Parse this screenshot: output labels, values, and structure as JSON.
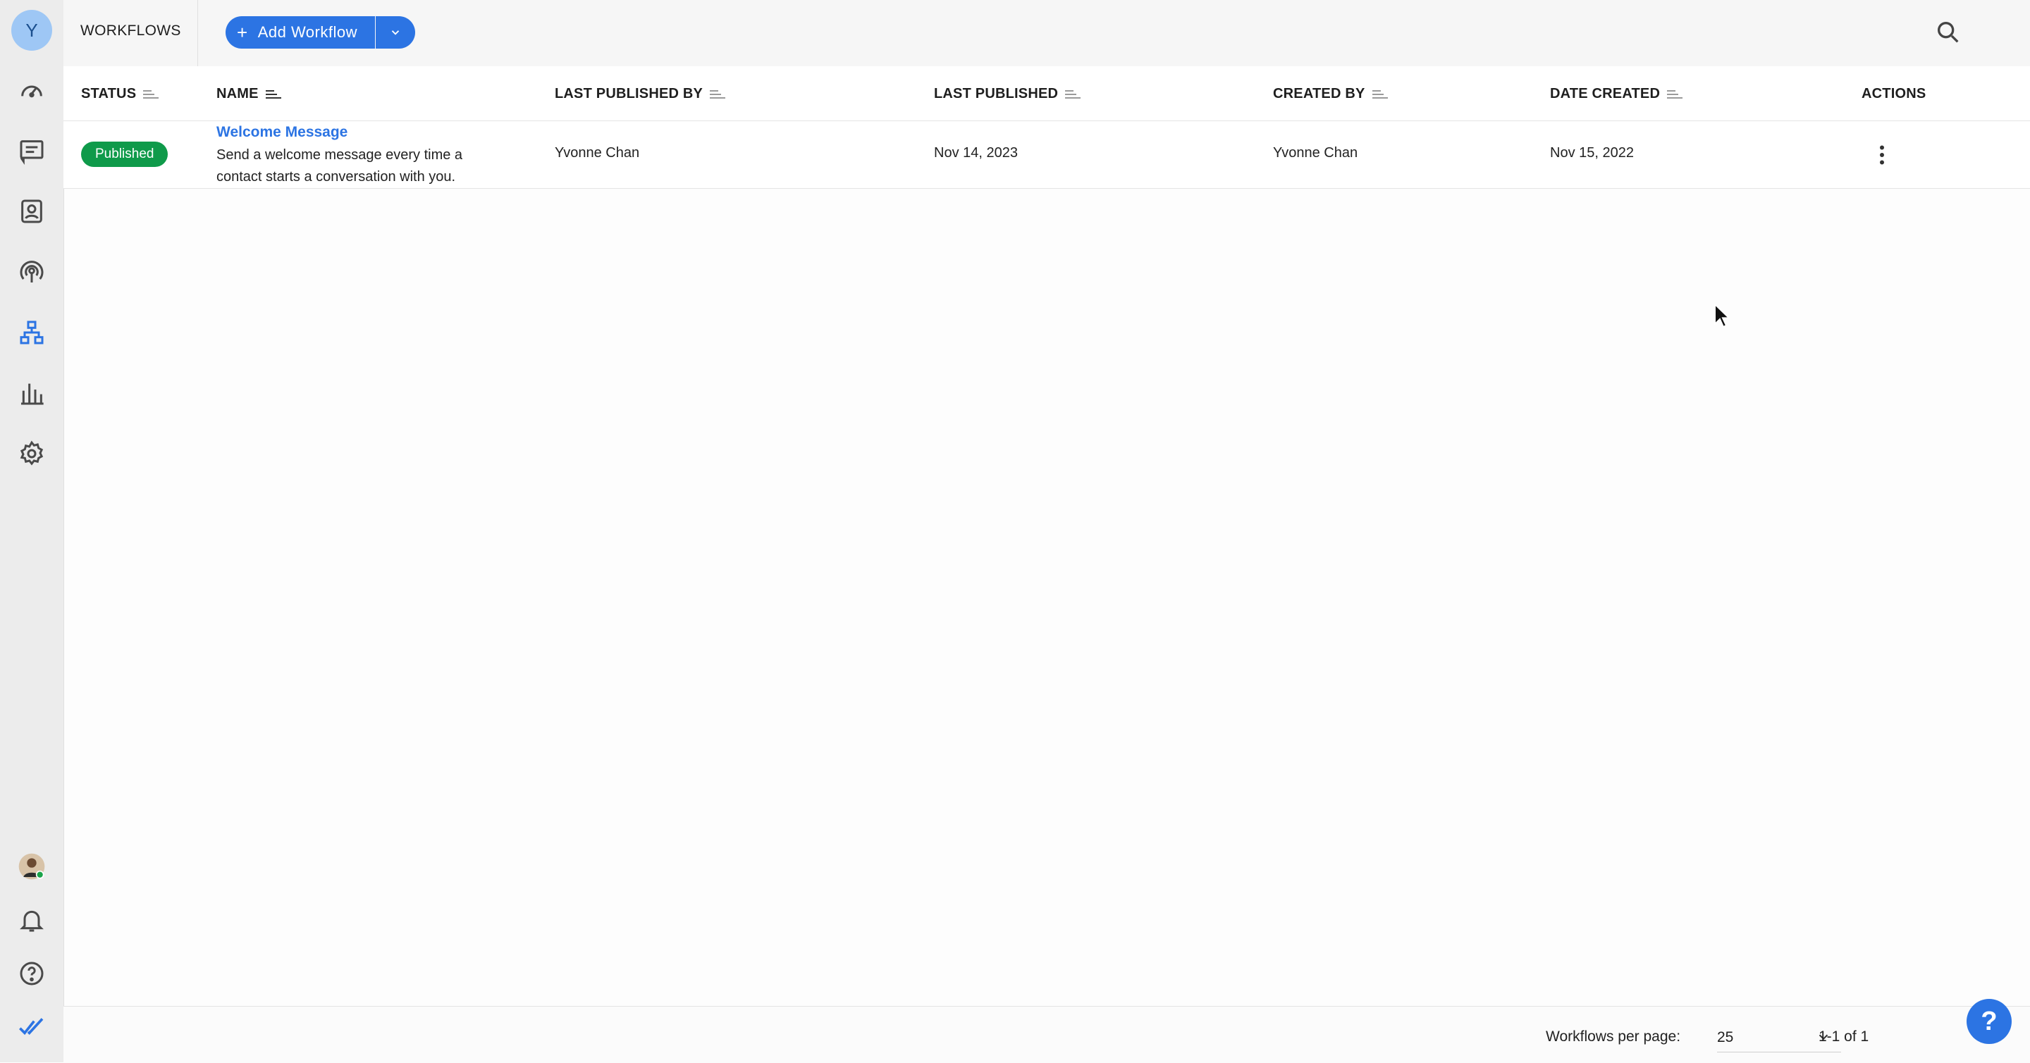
{
  "sidebar": {
    "avatar_initial": "Y",
    "items": [
      {
        "icon": "dashboard-gauge-icon"
      },
      {
        "icon": "messages-icon"
      },
      {
        "icon": "contacts-icon"
      },
      {
        "icon": "broadcast-icon"
      },
      {
        "icon": "workflows-icon",
        "active": true
      },
      {
        "icon": "reports-icon"
      },
      {
        "icon": "settings-gear-icon"
      }
    ],
    "bottom": [
      {
        "icon": "user-avatar-icon"
      },
      {
        "icon": "notifications-bell-icon"
      },
      {
        "icon": "help-circle-icon"
      },
      {
        "icon": "brand-checkmarks-icon"
      }
    ]
  },
  "header": {
    "title": "WORKFLOWS",
    "add_button_label": "Add Workflow"
  },
  "table": {
    "columns": [
      "STATUS",
      "NAME",
      "LAST PUBLISHED BY",
      "LAST PUBLISHED",
      "CREATED BY",
      "DATE CREATED",
      "ACTIONS"
    ],
    "rows": [
      {
        "status": "Published",
        "name": "Welcome Message",
        "description": "Send a welcome message every time a contact starts a conversation with you.",
        "last_published_by": "Yvonne Chan",
        "last_published": "Nov 14, 2023",
        "created_by": "Yvonne Chan",
        "date_created": "Nov 15, 2022"
      }
    ]
  },
  "footer": {
    "per_page_label": "Workflows per page:",
    "per_page_value": "25",
    "range": "1-1 of 1"
  },
  "help_fab": "?",
  "colors": {
    "accent": "#2c74e3",
    "published": "#0f9a4a",
    "sidebar_bg": "#ececec"
  }
}
